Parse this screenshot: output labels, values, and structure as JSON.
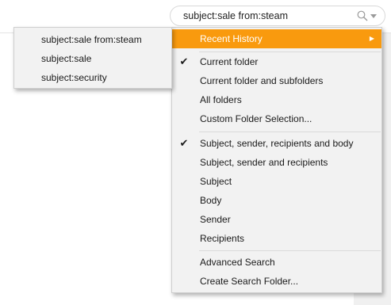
{
  "search": {
    "query": "subject:sale from:steam",
    "search_icon": "search-icon",
    "dropdown_icon": "chevron-down-icon"
  },
  "menu": {
    "recent_history": "Recent History",
    "scope_items": [
      {
        "label": "Current folder",
        "checked": true
      },
      {
        "label": "Current folder and subfolders",
        "checked": false
      },
      {
        "label": "All folders",
        "checked": false
      },
      {
        "label": "Custom Folder Selection...",
        "checked": false
      }
    ],
    "field_items": [
      {
        "label": "Subject, sender, recipients and body",
        "checked": true
      },
      {
        "label": "Subject, sender and recipients",
        "checked": false
      },
      {
        "label": "Subject",
        "checked": false
      },
      {
        "label": "Body",
        "checked": false
      },
      {
        "label": "Sender",
        "checked": false
      },
      {
        "label": "Recipients",
        "checked": false
      }
    ],
    "action_items": [
      {
        "label": "Advanced Search"
      },
      {
        "label": "Create Search Folder..."
      }
    ],
    "check_glyph": "✔",
    "submenu_arrow_glyph": "▶"
  },
  "history": {
    "items": [
      "subject:sale from:steam",
      "subject:sale",
      "subject:security"
    ]
  },
  "colors": {
    "highlight": "#f99a0e",
    "menu_bg": "#f2f2f2"
  }
}
